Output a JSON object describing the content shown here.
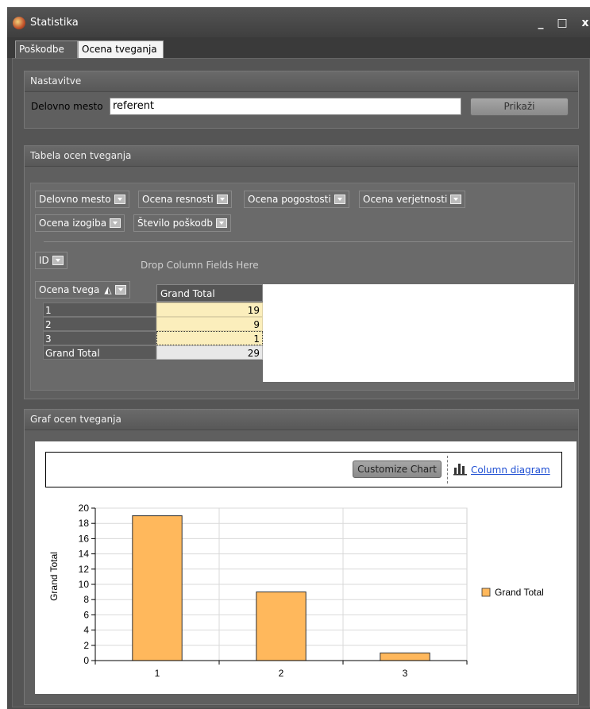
{
  "window": {
    "title": "Statistika",
    "controls": [
      "_",
      "□",
      "x"
    ]
  },
  "tabs": [
    {
      "label": "Poškodbe",
      "active": false
    },
    {
      "label": "Ocena tveganja",
      "active": true
    }
  ],
  "settings": {
    "title": "Nastavitve",
    "field_label": "Delovno mesto",
    "field_value": "referent",
    "button_label": "Prikaži"
  },
  "table_panel": {
    "title": "Tabela ocen tveganja",
    "filter_fields": [
      "Delovno mesto",
      "Ocena resnosti",
      "Ocena pogostosti",
      "Ocena verjetnosti",
      "Ocena izogiba",
      "Število poškodb"
    ],
    "row_field": "ID",
    "column_drop_hint": "Drop Column Fields Here",
    "row_header_field": "Ocena tvega",
    "data_header": "Grand Total",
    "rows": [
      {
        "label": "1",
        "value": "19"
      },
      {
        "label": "2",
        "value": "9"
      },
      {
        "label": "3",
        "value": "1"
      }
    ],
    "grand_total": {
      "label": "Grand Total",
      "value": "29"
    }
  },
  "chart_panel": {
    "title": "Graf ocen tveganja",
    "customize_label": "Customize Chart",
    "diagram_link": "Column diagram"
  },
  "chart_data": {
    "type": "bar",
    "categories": [
      "1",
      "2",
      "3"
    ],
    "series": [
      {
        "name": "Grand Total",
        "values": [
          19,
          9,
          1
        ]
      }
    ],
    "ylabel": "Grand Total",
    "ylim": [
      0,
      20
    ],
    "yticks": [
      0,
      2,
      4,
      6,
      8,
      10,
      12,
      14,
      16,
      18,
      20
    ],
    "bar_color": "#FFB85C",
    "legend_position": "right",
    "grid": true
  }
}
